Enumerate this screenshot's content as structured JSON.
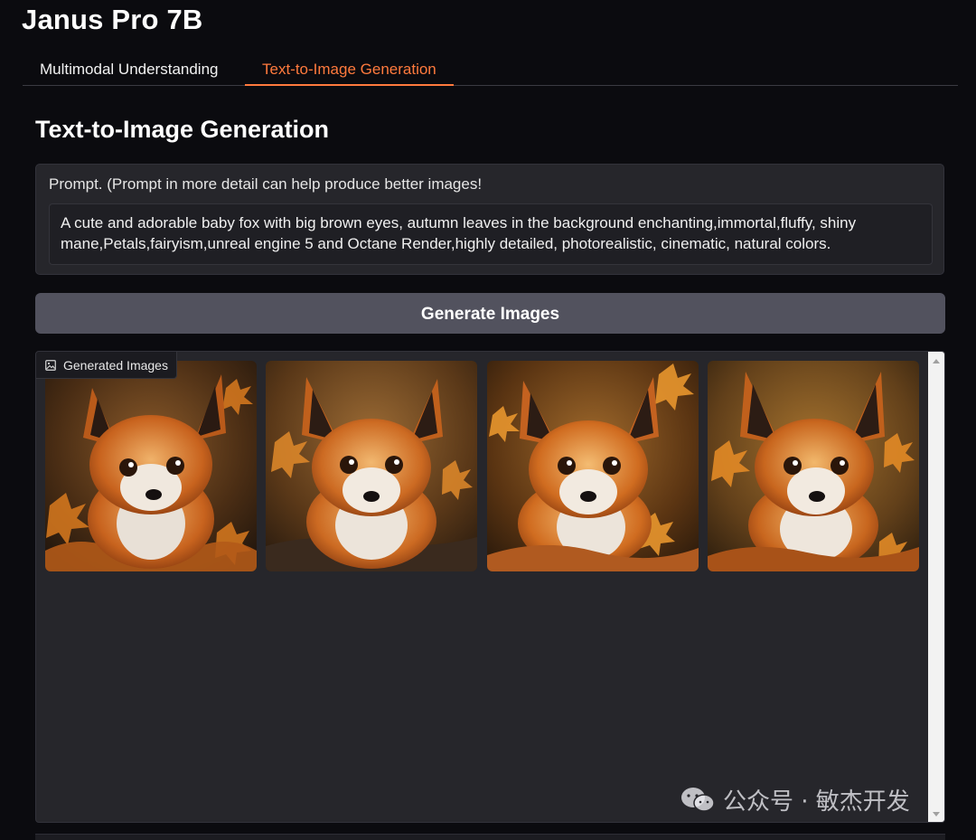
{
  "app": {
    "title": "Janus Pro 7B"
  },
  "tabs": [
    {
      "label": "Multimodal Understanding",
      "active": false
    },
    {
      "label": "Text-to-Image Generation",
      "active": true
    }
  ],
  "colors": {
    "accent": "#ff7a3d",
    "background": "#0b0b0f",
    "panel": "#26262b",
    "button": "#52525e"
  },
  "section": {
    "title": "Text-to-Image Generation"
  },
  "prompt": {
    "label": "Prompt. (Prompt in more detail can help produce better images!",
    "value": "A cute and adorable baby fox with big brown eyes, autumn leaves in the background enchanting,immortal,fluffy, shiny mane,Petals,fairyism,unreal engine 5 and Octane Render,highly detailed, photorealistic, cinematic, natural colors."
  },
  "generate_button": {
    "label": "Generate Images"
  },
  "gallery": {
    "label": "Generated Images",
    "label_icon": "image-icon",
    "images": [
      {
        "alt": "baby fox 1"
      },
      {
        "alt": "baby fox 2"
      },
      {
        "alt": "baby fox 3"
      },
      {
        "alt": "baby fox 4"
      }
    ]
  },
  "watermark": {
    "text": "公众号 · 敏杰开发",
    "icon": "wechat-icon"
  }
}
